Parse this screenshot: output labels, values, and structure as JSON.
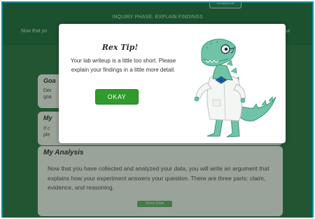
{
  "header": {
    "top_tab": "Notebook",
    "phase_title": "INQUIRY PHASE: EXPLAIN FINDINGS",
    "intro_left": "Now that yo",
    "intro_right": "your"
  },
  "cards": {
    "goal": {
      "title": "Goa",
      "snip1": "Det",
      "snip2": "goa"
    },
    "my": {
      "title": "My",
      "snip1": "If c",
      "snip2": "ple"
    },
    "analysis": {
      "title": "My Analysis",
      "body": "Now that you have collected and analyzed your data, you will write an argument that explains how your experiment answers your question. There are three parts: claim, evidence, and reasoning.",
      "show_data": "Show Data"
    }
  },
  "modal": {
    "title": "Rex Tip!",
    "message": "Your lab writeup is a little too short. Please explain your findings in a little more detail.",
    "button": "OKAY",
    "mascot_icon": "dinosaur-scientist-icon"
  },
  "colors": {
    "header_green": "#1f6b3a",
    "okay_green": "#2f9b2c",
    "frame_border": "#0e8fa0"
  }
}
